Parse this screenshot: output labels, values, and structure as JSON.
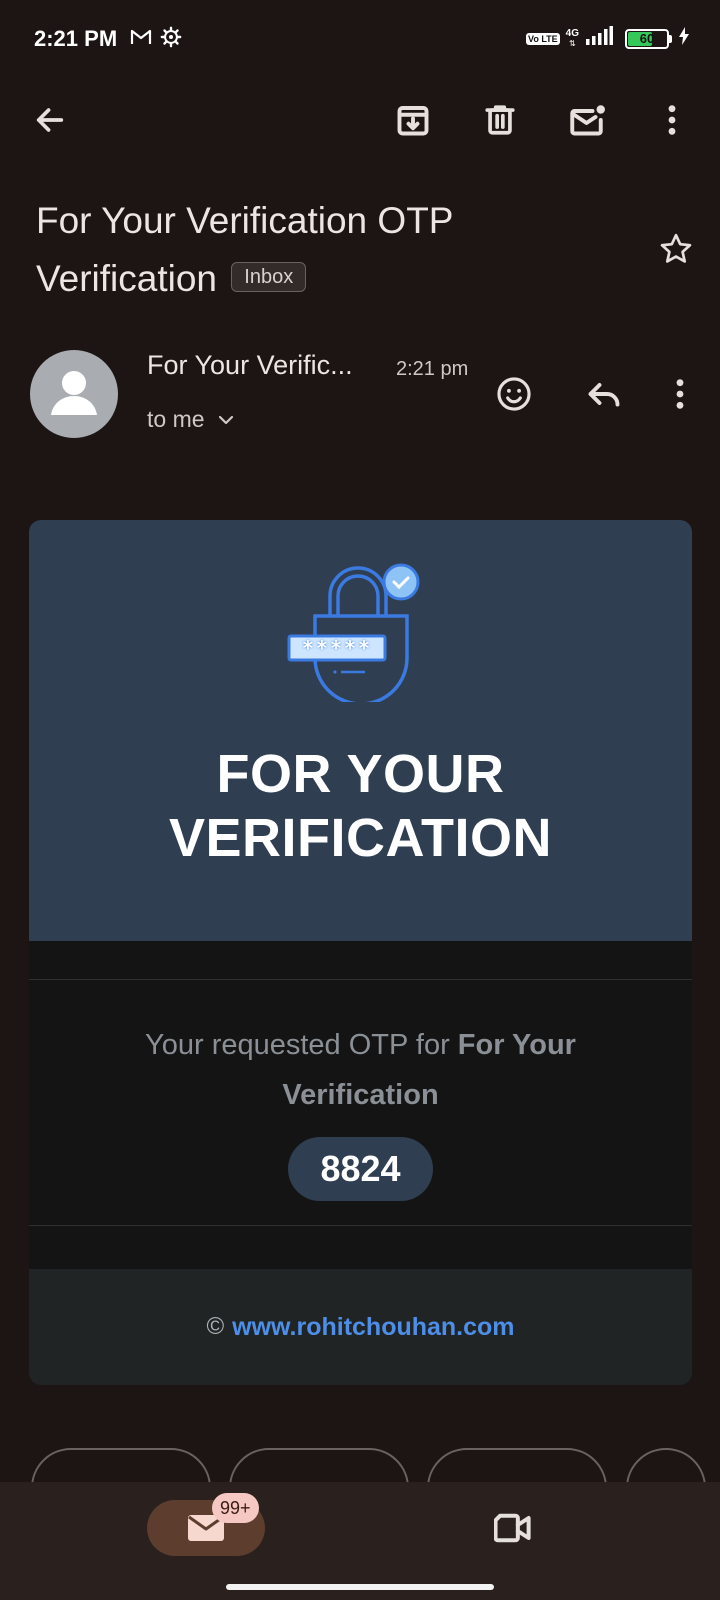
{
  "status_bar": {
    "time": "2:21 PM",
    "gmail_icon": "gmail-icon",
    "settings_icon": "gear-icon",
    "volte": "Vo LTE",
    "network": "4G",
    "battery": "60"
  },
  "toolbar": {
    "back_icon": "arrow-back-icon",
    "archive_icon": "archive-icon",
    "delete_icon": "trash-icon",
    "mark_unread_icon": "mail-unread-icon",
    "more_icon": "more-vertical-icon"
  },
  "email": {
    "subject_line1": "For Your Verification OTP",
    "subject_line2": "Verification",
    "label": "Inbox",
    "sender": "For Your Verific...",
    "time": "2:21 pm",
    "recipient": "to me"
  },
  "body": {
    "title_line1": "FOR YOUR",
    "title_line2": "VERIFICATION",
    "message_prefix": "Your requested OTP for",
    "message_bold_1": "For Your",
    "message_bold_2": "Verification",
    "otp": "8824",
    "copyright": "©",
    "website": "www.rohitchouhan.com",
    "password_mask": "*****"
  },
  "bottom_nav": {
    "mail_badge": "99+",
    "mail_icon": "mail-icon",
    "meet_icon": "video-icon"
  },
  "colors": {
    "background": "#1d1513",
    "hero": "#2f3e51",
    "link": "#4c8ee8",
    "badge": "#f6c8c4",
    "nav_active": "#5c3d2e"
  }
}
